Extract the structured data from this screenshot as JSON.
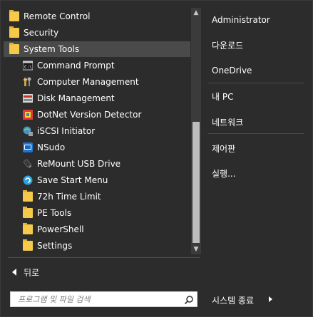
{
  "programs": {
    "items": [
      {
        "label": "Remote Control",
        "icon": "folder-icon"
      },
      {
        "label": "Security",
        "icon": "folder-icon"
      },
      {
        "label": "System Tools",
        "icon": "folder-icon"
      },
      {
        "label": "Command Prompt",
        "icon": "command-prompt-icon"
      },
      {
        "label": "Computer Management",
        "icon": "computer-management-icon"
      },
      {
        "label": "Disk Management",
        "icon": "disk-management-icon"
      },
      {
        "label": "DotNet Version Detector",
        "icon": "dotnet-icon"
      },
      {
        "label": "iSCSI Initiator",
        "icon": "iscsi-icon"
      },
      {
        "label": "NSudo",
        "icon": "nsudo-icon"
      },
      {
        "label": "ReMount USB Drive",
        "icon": "usb-icon"
      },
      {
        "label": "Save Start Menu",
        "icon": "save-start-menu-icon"
      },
      {
        "label": "72h Time Limit",
        "icon": "folder-icon"
      },
      {
        "label": "PE Tools",
        "icon": "folder-icon"
      },
      {
        "label": "PowerShell",
        "icon": "folder-icon"
      },
      {
        "label": "Settings",
        "icon": "folder-icon"
      }
    ]
  },
  "back": {
    "label": "뒤로"
  },
  "search": {
    "placeholder": "프로그램 및 파일 검색"
  },
  "right_pane": {
    "items": [
      {
        "label": "Administrator"
      },
      {
        "label": "다운로드"
      },
      {
        "label": "OneDrive"
      },
      {
        "label": "내 PC"
      },
      {
        "label": "네트워크"
      },
      {
        "label": "제어판"
      },
      {
        "label": "실행..."
      }
    ]
  },
  "shutdown": {
    "label": "시스템 종료"
  },
  "colors": {
    "background": "#2c2c2c",
    "selected": "#4a4a4a",
    "folder": "#f5c94a"
  }
}
